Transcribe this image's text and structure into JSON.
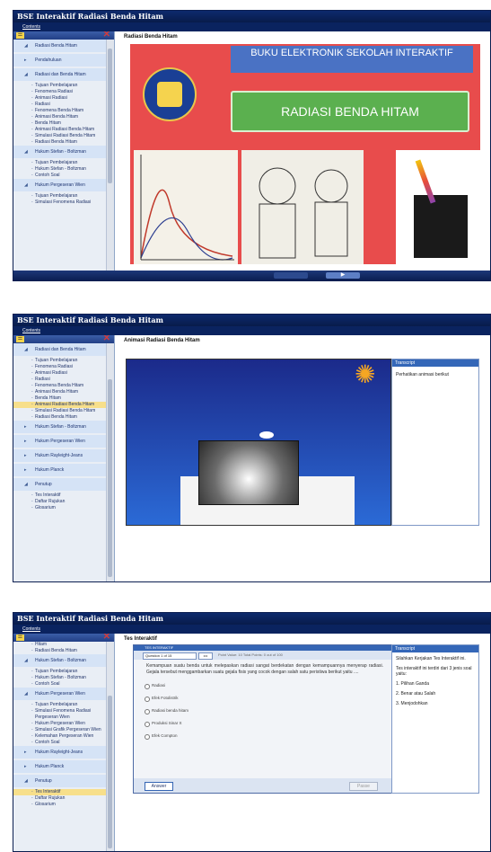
{
  "app_title": "BSE Interaktif Radiasi Benda Hitam",
  "menu": "Contents",
  "screen1": {
    "content_title": "Radiasi Benda Hitam",
    "cover_top": "BUKU ELEKTRONIK SEKOLAH INTERAKTIF",
    "cover_title": "RADIASI BENDA HITAM",
    "toc": [
      {
        "label": "Radiasi Benda Hitam",
        "type": "ch",
        "arrow": "◢"
      },
      {
        "label": "Pendahuluan",
        "type": "ch",
        "arrow": "▸"
      },
      {
        "label": "Radiasi dan Benda Hitam",
        "type": "ch",
        "arrow": "◢"
      },
      {
        "label": "Tujuan Pembelajaran",
        "type": "sub"
      },
      {
        "label": "Fenomena Radiasi",
        "type": "sub"
      },
      {
        "label": "Animasi Radiasi",
        "type": "sub"
      },
      {
        "label": "Radiasi",
        "type": "sub"
      },
      {
        "label": "Fenomena Benda Hitam",
        "type": "sub"
      },
      {
        "label": "Animasi Benda Hitam",
        "type": "sub"
      },
      {
        "label": "Benda Hitam",
        "type": "sub"
      },
      {
        "label": "Animasi Radiasi Benda Hitam",
        "type": "sub"
      },
      {
        "label": "Simulasi Radiasi Benda Hitam",
        "type": "sub"
      },
      {
        "label": "Radiasi Benda Hitam",
        "type": "sub"
      },
      {
        "label": "Hukum Stefan - Boltzman",
        "type": "ch",
        "arrow": "◢"
      },
      {
        "label": "Tujuan Pembelajaran",
        "type": "sub"
      },
      {
        "label": "Hukum Stefan - Boltzman",
        "type": "sub"
      },
      {
        "label": "Contoh Soal",
        "type": "sub"
      },
      {
        "label": "Hukum Pergeseran Wien",
        "type": "ch",
        "arrow": "◢"
      },
      {
        "label": "Tujuan Pembelajaran",
        "type": "sub"
      },
      {
        "label": "Simulasi Fenomena Radiasi",
        "type": "sub"
      }
    ]
  },
  "screen2": {
    "content_title": "Animasi Radiasi Benda Hitam",
    "transcript_header": "Transcript",
    "transcript_text": "Perhatikan animasi berikut",
    "toc": [
      {
        "label": "Radiasi dan Benda Hitam",
        "type": "ch",
        "arrow": "◢"
      },
      {
        "label": "Tujuan Pembelajaran",
        "type": "sub"
      },
      {
        "label": "Fenomena Radiasi",
        "type": "sub"
      },
      {
        "label": "Animasi Radiasi",
        "type": "sub"
      },
      {
        "label": "Radiasi",
        "type": "sub"
      },
      {
        "label": "Fenomena Benda Hitam",
        "type": "sub"
      },
      {
        "label": "Animasi Benda Hitam",
        "type": "sub"
      },
      {
        "label": "Benda Hitam",
        "type": "sub"
      },
      {
        "label": "Animasi Radiasi Benda Hitam",
        "type": "sub",
        "selected": true
      },
      {
        "label": "Simulasi Radiasi Benda Hitam",
        "type": "sub"
      },
      {
        "label": "Radiasi Benda Hitam",
        "type": "sub"
      },
      {
        "label": "Hukum Stefan - Boltzman",
        "type": "ch",
        "arrow": "▸"
      },
      {
        "label": "Hukum Pergeseran Wien",
        "type": "ch",
        "arrow": "▸"
      },
      {
        "label": "Hukum Rayleight-Jeans",
        "type": "ch",
        "arrow": "▸"
      },
      {
        "label": "Hukum Planck",
        "type": "ch",
        "arrow": "▸"
      },
      {
        "label": "Penutup",
        "type": "ch",
        "arrow": "◢"
      },
      {
        "label": "Tes Interaktif",
        "type": "sub"
      },
      {
        "label": "Daftar Rujukan",
        "type": "sub"
      },
      {
        "label": "Glosarium",
        "type": "sub"
      }
    ]
  },
  "screen3": {
    "content_title": "Tes Interaktif",
    "transcript_header": "Transcript",
    "transcript_lines": [
      "Silahkan Kerjakan Tes Interaktif ini.",
      "Tes interaktif ini terdiri dari 3 jenis soal yaitu:",
      "1. Pilihan Ganda",
      "2. Benar atau Salah",
      "3. Menjodohkan"
    ],
    "quiz": {
      "header": "TES INTERAKTIF",
      "question_select": "Question 1 of 15",
      "nav": "◂ ▸",
      "info": "Point Value: 10   Total Points: 0 out of 100",
      "question": "Kemampuan suatu benda untuk melepaskan radiasi sangat berdekatan dengan kemampuannya menyerap radiasi. Gejala tersebut menggambarkan suatu gejala fisis yang cocok dengan salah satu peristiwa berikut yaitu ....",
      "options": [
        "Radiasi",
        "Efek Fotolistrik",
        "Radiasi benda hitam",
        "Produksi Sinar X",
        "Efek Compton"
      ],
      "answer_button": "Answer",
      "pass_button": "Passe"
    },
    "toc": [
      {
        "label": "Hitam",
        "type": "sub"
      },
      {
        "label": "Radiasi Benda Hitam",
        "type": "sub"
      },
      {
        "label": "Hukum Stefan - Boltzman",
        "type": "ch",
        "arrow": "◢"
      },
      {
        "label": "Tujuan Pembelajaran",
        "type": "sub"
      },
      {
        "label": "Hukum Stefan - Boltzman",
        "type": "sub"
      },
      {
        "label": "Contoh Soal",
        "type": "sub"
      },
      {
        "label": "Hukum Pergeseran Wien",
        "type": "ch",
        "arrow": "◢"
      },
      {
        "label": "Tujuan Pembelajaran",
        "type": "sub"
      },
      {
        "label": "Simulasi Fenomena Radiasi Pergeseran Wien",
        "type": "sub"
      },
      {
        "label": "Hukum Pergeseran Wien",
        "type": "sub"
      },
      {
        "label": "Simulasi Grafik Pergeseran Wien",
        "type": "sub"
      },
      {
        "label": "Kelemahan Pergeseran Wien",
        "type": "sub"
      },
      {
        "label": "Contoh Soal",
        "type": "sub"
      },
      {
        "label": "Hukum Rayleight-Jeans",
        "type": "ch",
        "arrow": "▸"
      },
      {
        "label": "Hukum Planck",
        "type": "ch",
        "arrow": "▸"
      },
      {
        "label": "Penutup",
        "type": "ch",
        "arrow": "◢"
      },
      {
        "label": "Tes Interaktif",
        "type": "sub",
        "selected": true
      },
      {
        "label": "Daftar Rujukan",
        "type": "sub"
      },
      {
        "label": "Glosarium",
        "type": "sub"
      }
    ]
  }
}
